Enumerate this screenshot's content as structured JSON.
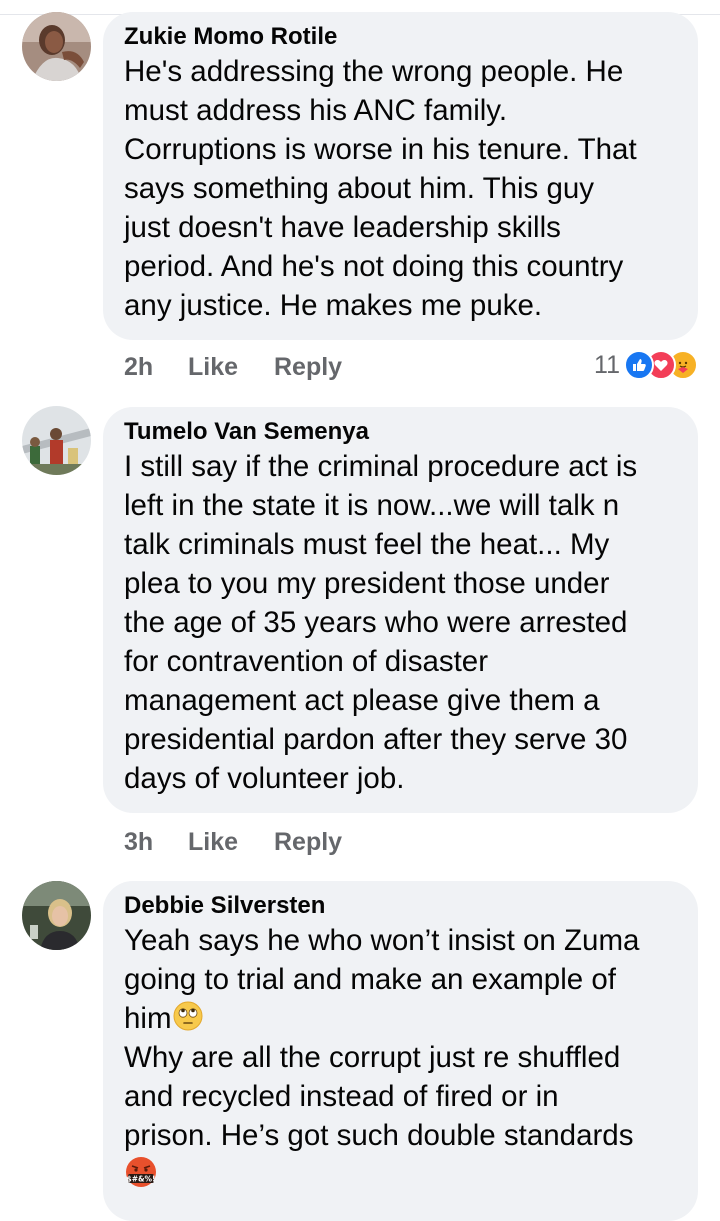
{
  "comments": [
    {
      "author": "Zukie Momo Rotile",
      "text": "He's addressing the wrong people. He\nmust address his ANC family.\nCorruptions is worse in his tenure. That\nsays something about him. This guy\njust doesn't have leadership skills\nperiod. And he's not doing this country\nany justice. He makes me puke.",
      "time": "2h",
      "like_label": "Like",
      "reply_label": "Reply",
      "reaction_count": "11",
      "reactions": [
        "like-icon",
        "love-icon",
        "care-icon"
      ]
    },
    {
      "author": "Tumelo Van Semenya",
      "text": "I still say if the criminal procedure act is\nleft in the state it is now...we will talk n\ntalk criminals must feel the heat... My\nplea to you my president those under\nthe age of 35 years who were arrested\nfor contravention of disaster\nmanagement act please give them a\npresidential pardon after they serve 30\ndays of volunteer job.",
      "time": "3h",
      "like_label": "Like",
      "reply_label": "Reply"
    },
    {
      "author": "Debbie Silversten",
      "text_line1": "Yeah says he who won’t insist on Zuma\ngoing to trial and make an example of\nhim",
      "text_line2": "Why are all the corrupt just re shuffled\nand recycled instead of fired or in\nprison. He’s got such double standards",
      "emojis": [
        "eye-roll-emoji",
        "cursing-face-emoji"
      ],
      "cursing_glyphs": "$#&%!"
    }
  ],
  "colors": {
    "bubble": "#f0f2f5",
    "text": "#050505",
    "meta": "#65676b",
    "like_blue": "#1877f2",
    "love_red": "#f33e58",
    "care_yellow": "#f7b125"
  }
}
